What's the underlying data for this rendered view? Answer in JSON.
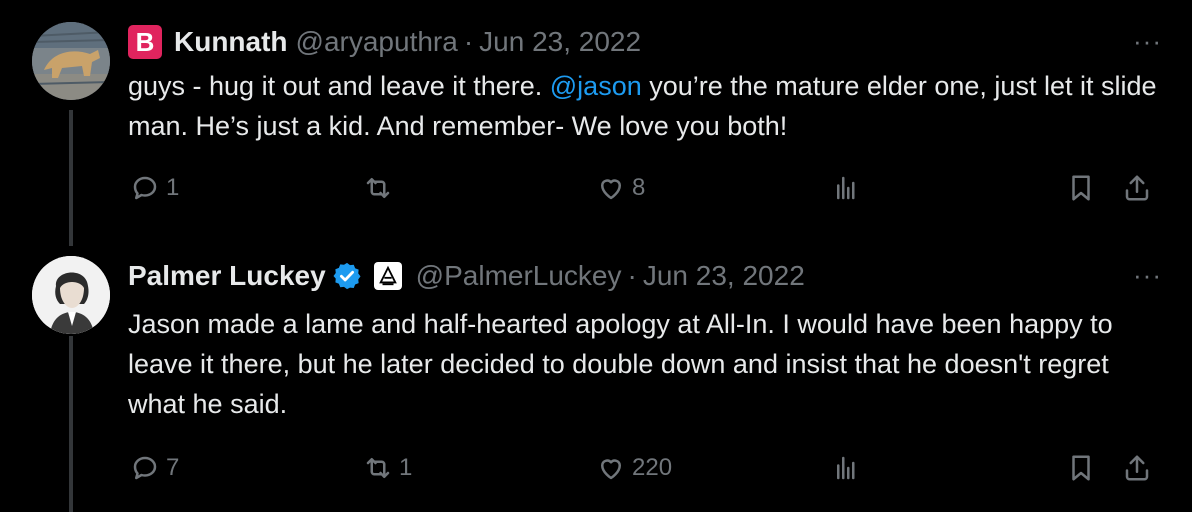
{
  "tweets": [
    {
      "name": "Kunnath",
      "badge": "B",
      "handle": "@aryaputhra",
      "dot": "·",
      "date": "Jun 23, 2022",
      "more": "···",
      "text_before": "guys - hug it out and leave it there. ",
      "mention": "@jason",
      "text_after": " you’re the mature elder one, just let it slide man. He’s just a kid. And remember- We love you both!",
      "replies": "1",
      "retweets": "",
      "likes": "8",
      "colors": {
        "badge": "#e0245e"
      }
    },
    {
      "name": "Palmer Luckey",
      "verified": true,
      "handle": "@PalmerLuckey",
      "dot": "·",
      "date": "Jun 23, 2022",
      "more": "···",
      "text": "Jason made a lame and half-hearted apology at All-In.  I would have been happy to leave it there, but he later decided to double down and insist that he doesn't regret what he said.",
      "replies": "7",
      "retweets": "1",
      "likes": "220",
      "colors": {
        "verified": "#1d9bf0"
      }
    }
  ],
  "theme": {
    "background": "#000000",
    "text": "#e7e9ea",
    "muted": "#71767b",
    "link": "#1d9bf0",
    "thread_line": "#333639"
  }
}
